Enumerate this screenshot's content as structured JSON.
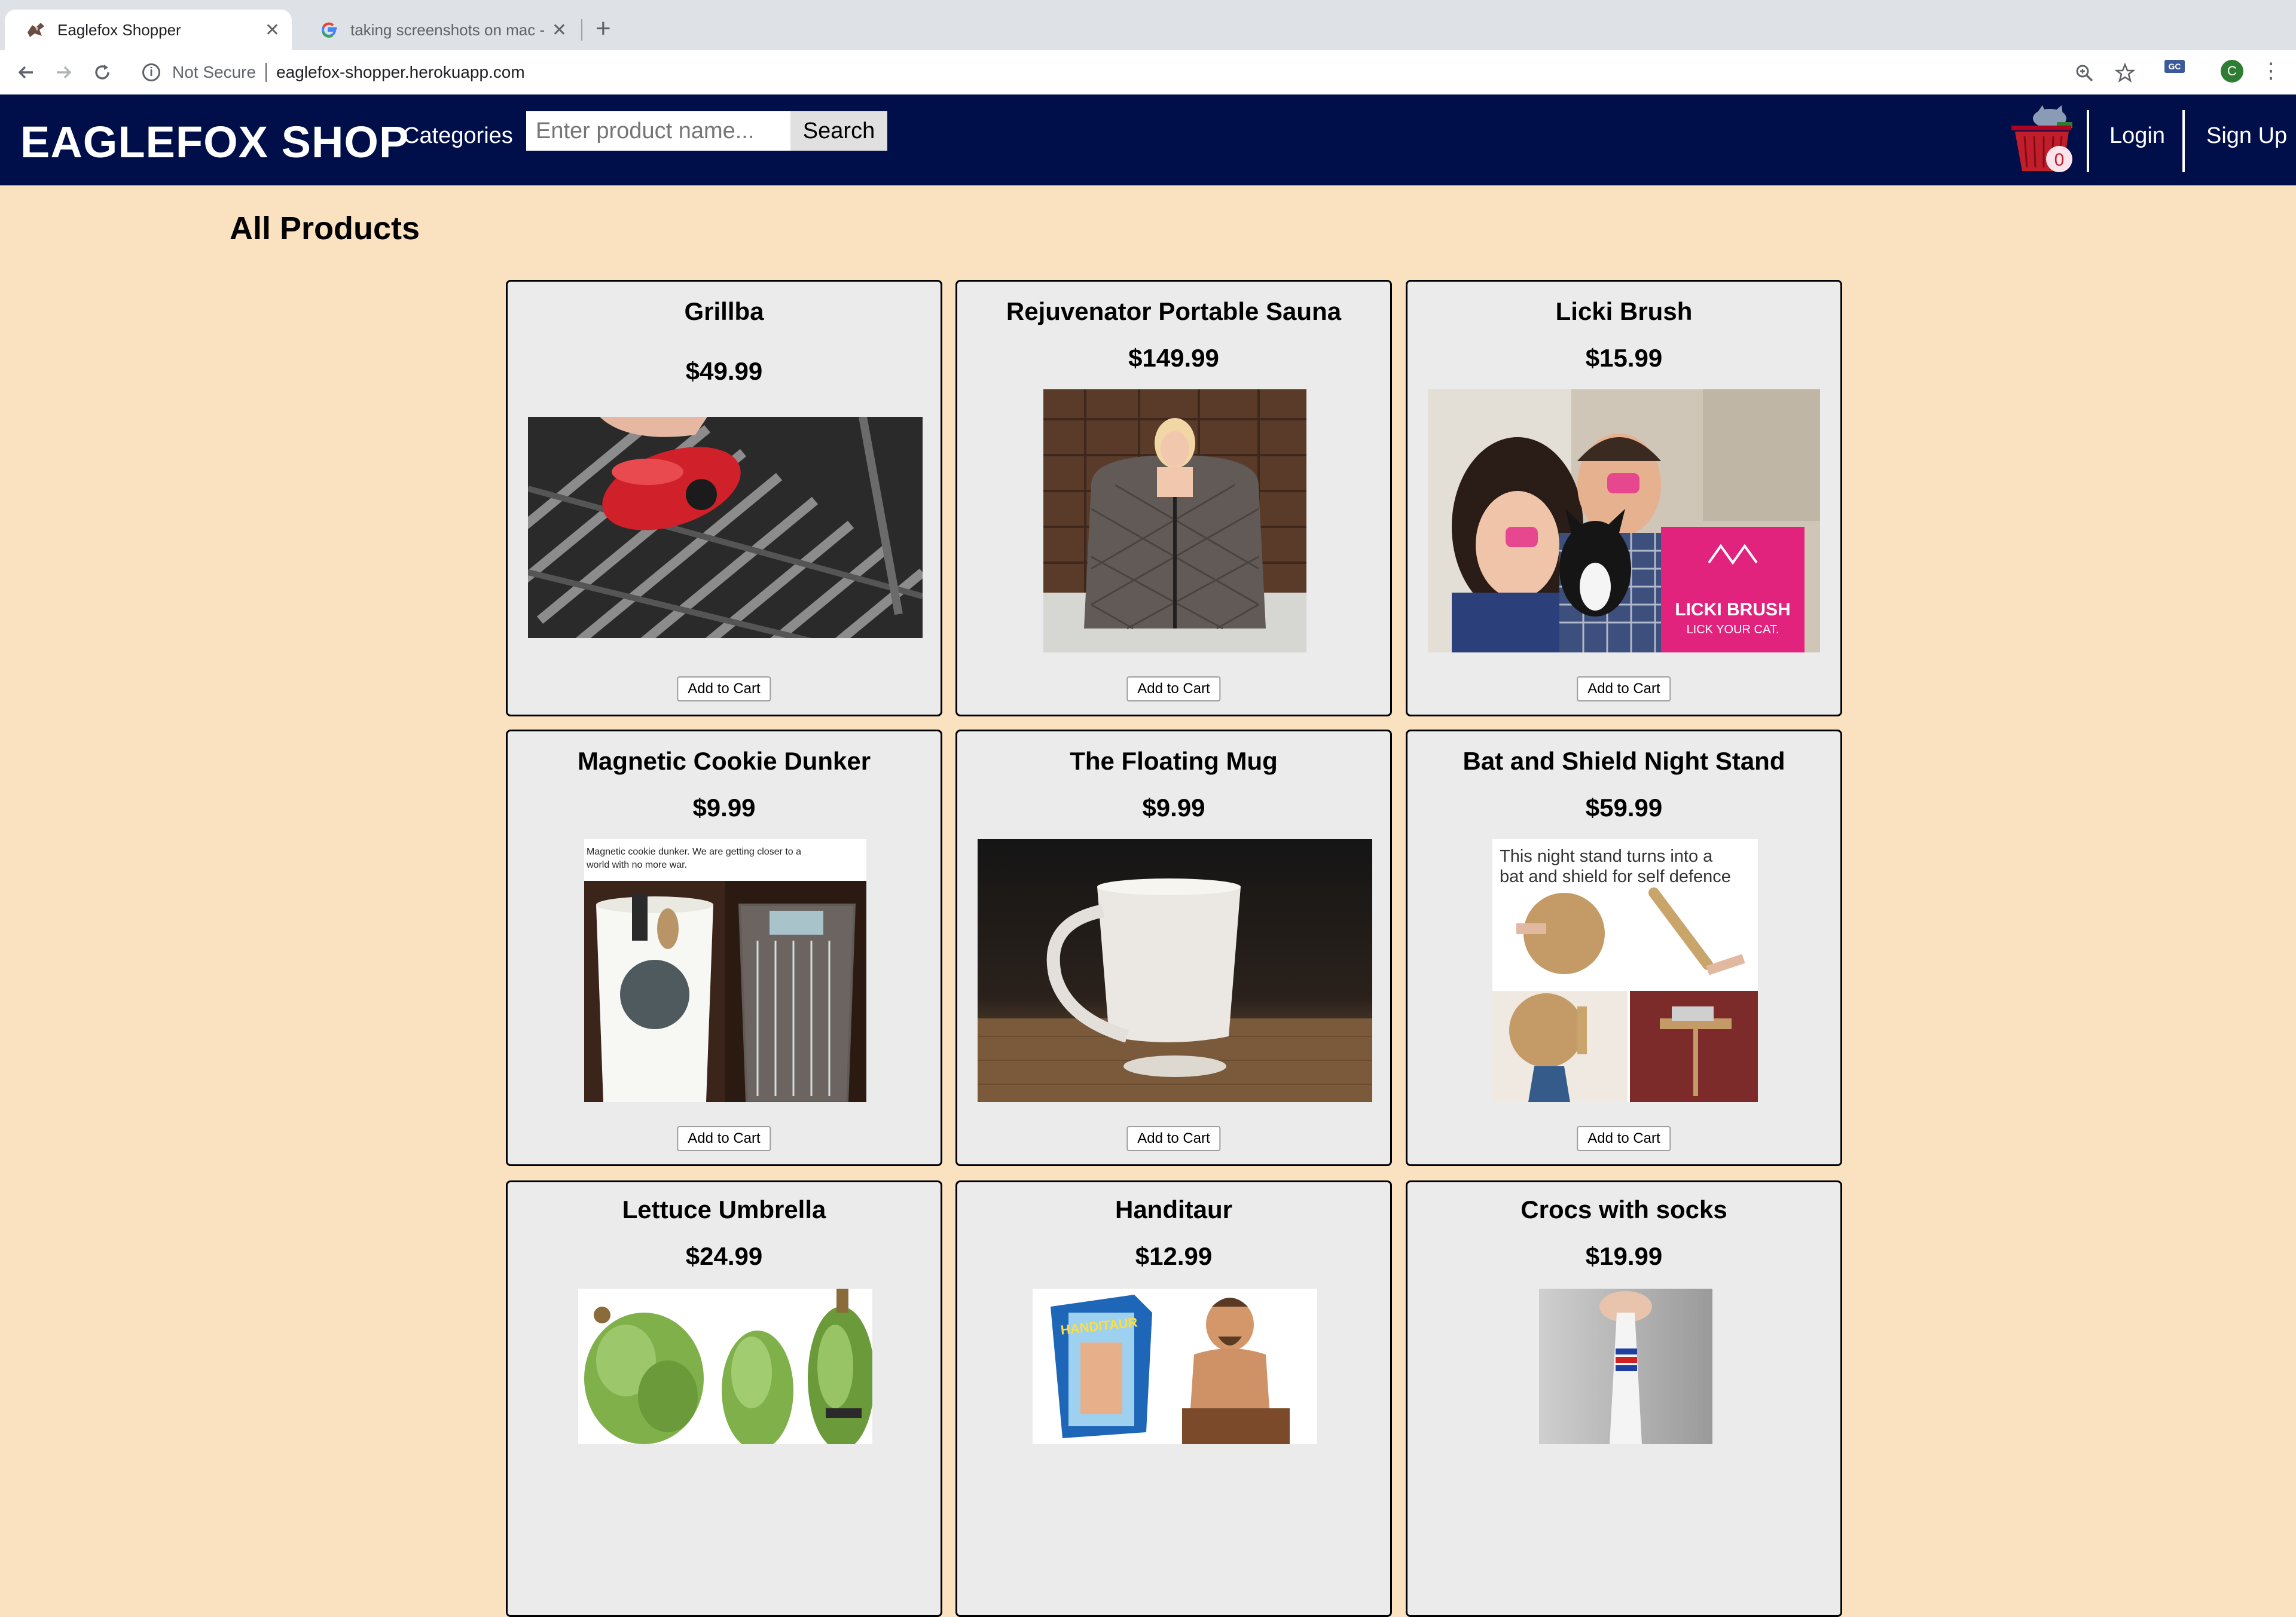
{
  "browser": {
    "tabs": [
      {
        "title": "Eaglefox Shopper",
        "active": true
      },
      {
        "title": "taking screenshots on mac - G",
        "active": false
      }
    ],
    "new_tab": "+",
    "security_label": "Not Secure",
    "url": "eaglefox-shopper.herokuapp.com",
    "profile_initial": "C",
    "extension_label": "GC"
  },
  "header": {
    "logo": "EAGLEFOX SHOP",
    "categories": "Categories",
    "search_placeholder": "Enter product name...",
    "search_button": "Search",
    "cart_count": "0",
    "login": "Login",
    "signup": "Sign Up",
    "colors": {
      "background": "#000f4a",
      "text": "#ffffff"
    }
  },
  "main": {
    "title": "All Products",
    "add_to_cart_label": "Add to Cart",
    "background": "#fae1c0",
    "products": [
      {
        "name": "Grillba",
        "price": "$49.99"
      },
      {
        "name": "Rejuvenator Portable Sauna",
        "price": "$149.99"
      },
      {
        "name": "Licki Brush",
        "price": "$15.99",
        "image_text": [
          "LICKI BRUSH",
          "LICK YOUR CAT."
        ]
      },
      {
        "name": "Magnetic Cookie Dunker",
        "price": "$9.99",
        "image_text": [
          "Magnetic cookie dunker. We are getting closer to a",
          "world with no more war."
        ]
      },
      {
        "name": "The Floating Mug",
        "price": "$9.99"
      },
      {
        "name": "Bat and Shield Night Stand",
        "price": "$59.99",
        "image_text": [
          "This night stand turns into a",
          "bat and shield for self defence"
        ]
      },
      {
        "name": "Lettuce Umbrella",
        "price": "$24.99"
      },
      {
        "name": "Handitaur",
        "price": "$12.99",
        "image_text": [
          "HANDITAUR"
        ]
      },
      {
        "name": "Crocs with socks",
        "price": "$19.99"
      }
    ]
  }
}
